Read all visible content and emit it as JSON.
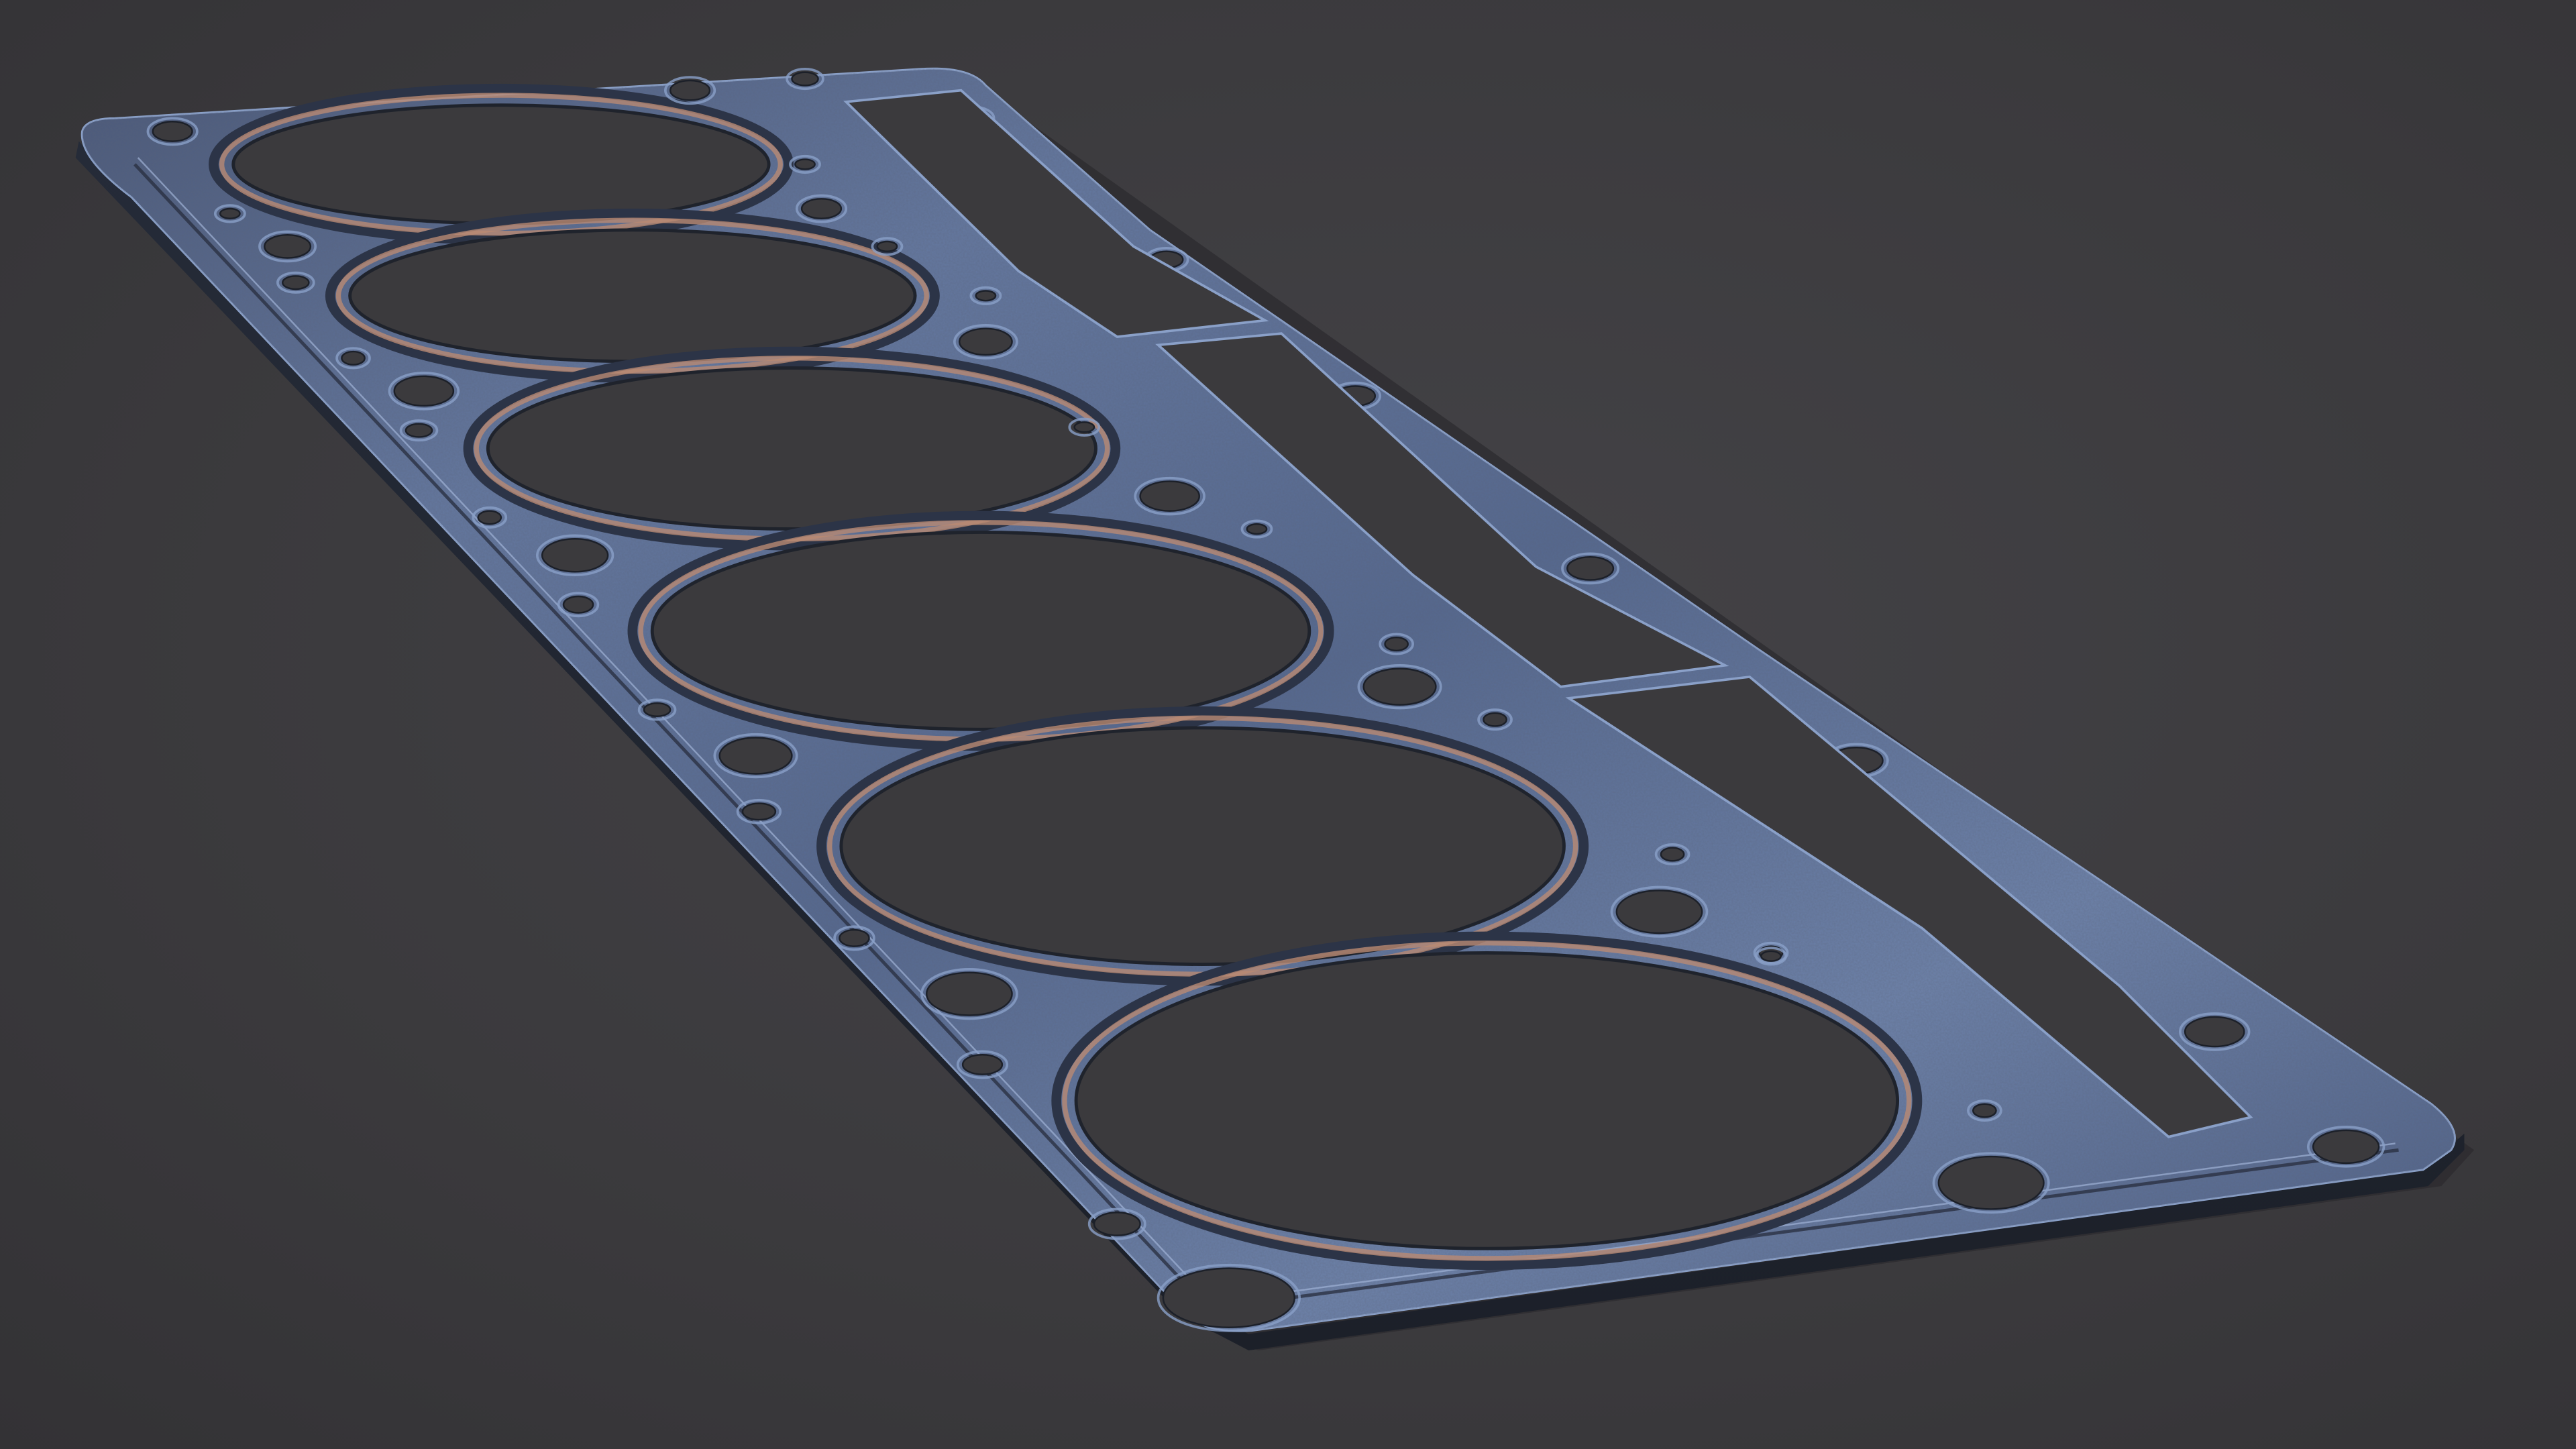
{
  "scene": {
    "subject": "cylinder-head-gasket",
    "cylinder_count": 6,
    "colors": {
      "background": "#3b3a3d",
      "gasket_metal": "#5b6f96",
      "gasket_highlight": "#8aa0c8",
      "gasket_shadow": "#2c3447",
      "bead_copper": "#b98a73",
      "hole_interior": "#3b3a3d"
    }
  }
}
